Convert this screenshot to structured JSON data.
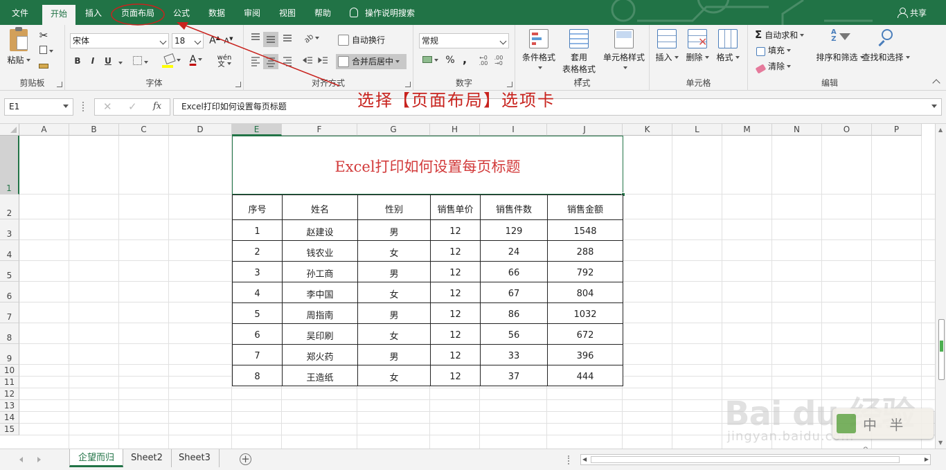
{
  "tabs": [
    "文件",
    "开始",
    "插入",
    "页面布局",
    "公式",
    "数据",
    "审阅",
    "视图",
    "帮助"
  ],
  "tell_me": "操作说明搜索",
  "share": "共享",
  "ribbon": {
    "clipboard": {
      "label": "剪贴板",
      "paste": "粘贴"
    },
    "font": {
      "label": "字体",
      "font_name": "宋体",
      "font_size": "18",
      "bold": "B",
      "italic": "I",
      "underline": "U"
    },
    "alignment": {
      "label": "对齐方式",
      "wrap": "自动换行",
      "merge": "合并后居中"
    },
    "number": {
      "label": "数字",
      "format": "常规",
      "percent": "%",
      "comma": ","
    },
    "styles": {
      "label": "样式",
      "conditional": "条件格式",
      "table_1": "套用",
      "table_2": "表格格式",
      "cell_styles": "单元格样式"
    },
    "cells": {
      "label": "单元格",
      "insert": "插入",
      "delete": "删除",
      "format": "格式"
    },
    "editing": {
      "label": "编辑",
      "autosum": "自动求和",
      "fill": "填充",
      "clear": "清除",
      "sort": "排序和筛选",
      "find": "查找和选择"
    }
  },
  "formula_bar": {
    "name_box": "E1",
    "fx": "fx",
    "content": "Excel打印如何设置每页标题"
  },
  "columns": [
    "A",
    "B",
    "C",
    "D",
    "E",
    "F",
    "G",
    "H",
    "I",
    "J",
    "K",
    "L",
    "M",
    "N",
    "O",
    "P"
  ],
  "rows": [
    "1",
    "2",
    "3",
    "4",
    "5",
    "6",
    "7",
    "8",
    "9",
    "10",
    "11",
    "12",
    "13",
    "14",
    "15"
  ],
  "title_cell": "Excel打印如何设置每页标题",
  "table": {
    "headers": [
      "序号",
      "姓名",
      "性别",
      "销售单价",
      "销售件数",
      "销售金额"
    ],
    "rows": [
      [
        "1",
        "赵建设",
        "男",
        "12",
        "129",
        "1548"
      ],
      [
        "2",
        "钱农业",
        "女",
        "12",
        "24",
        "288"
      ],
      [
        "3",
        "孙工商",
        "男",
        "12",
        "66",
        "792"
      ],
      [
        "4",
        "李中国",
        "女",
        "12",
        "67",
        "804"
      ],
      [
        "5",
        "周指南",
        "男",
        "12",
        "86",
        "1032"
      ],
      [
        "6",
        "吴印刷",
        "女",
        "12",
        "56",
        "672"
      ],
      [
        "7",
        "郑火药",
        "男",
        "12",
        "33",
        "396"
      ],
      [
        "8",
        "王造纸",
        "女",
        "12",
        "37",
        "444"
      ]
    ]
  },
  "annotation": "选择【页面布局】选项卡",
  "sheet_tabs": [
    "企望而归",
    "Sheet2",
    "Sheet3"
  ],
  "add_sheet": "+",
  "watermark": {
    "logo": "Bai du 经验",
    "url": "jingyan.baidu.com",
    "badge": "中 半 。"
  },
  "colors": {
    "accent": "#217346",
    "annotation": "#c8231e",
    "title_text": "#d23a3a"
  }
}
